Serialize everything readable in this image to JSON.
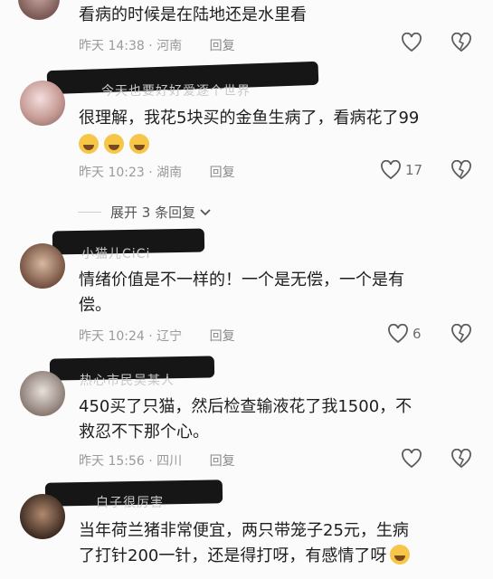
{
  "comments": [
    {
      "text": "看病的时候是在陆地还是水里看",
      "time": "昨天 14:38",
      "location": "河南",
      "reply_label": "回复",
      "likes": ""
    },
    {
      "username_faded": "今天也要好好爱逐个世界",
      "text": "很理解，我花5块买的金鱼生病了，看病花了99",
      "time": "昨天 10:23",
      "location": "湖南",
      "reply_label": "回复",
      "likes": "17"
    },
    {
      "username_faded": "小猫儿CiCi",
      "text_line1": "情绪价值是不一样的！一个是无偿，一个是有",
      "text_line2": "偿。",
      "time": "昨天 10:24",
      "location": "辽宁",
      "reply_label": "回复",
      "likes": "6"
    },
    {
      "username_faded": "热心市民吴某人",
      "text_line1": "450买了只猫，然后检查输液花了我1500，不",
      "text_line2": "救忍不下那个心。",
      "time": "昨天 15:56",
      "location": "四川",
      "reply_label": "回复",
      "likes": ""
    },
    {
      "username_faded": "白子很厉害",
      "text_line1": "当年荷兰猪非常便宜，两只带笼子25元，生病",
      "text_line2": "了打针200一针，还是得打呀，有感情了呀",
      "time": "",
      "location": "",
      "reply_label": "",
      "likes": ""
    }
  ],
  "expand_replies": "展开 3 条回复",
  "icons": {
    "like": "heart-outline-icon",
    "dislike": "broken-heart-icon",
    "expand": "chevron-down-icon",
    "emoji": "crying-laughing-emoji"
  }
}
